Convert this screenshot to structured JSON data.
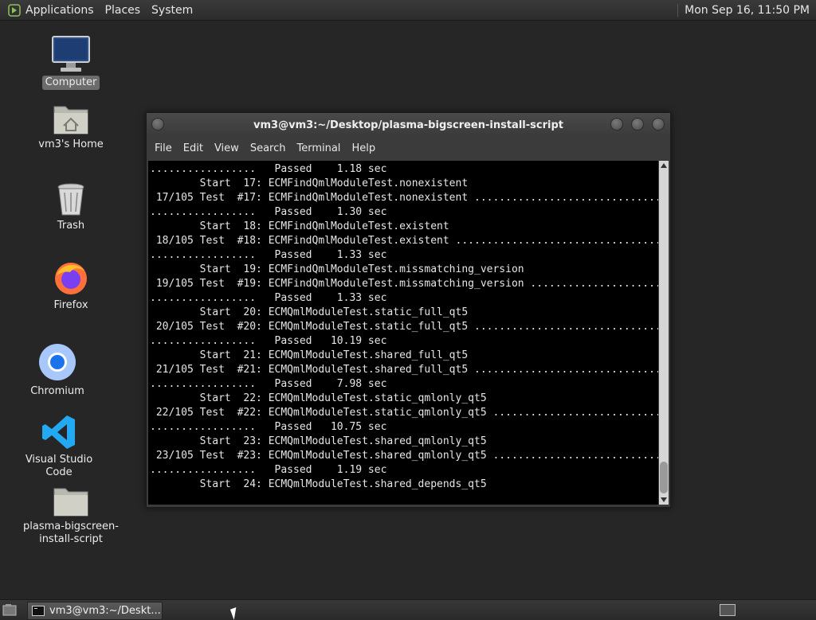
{
  "top_panel": {
    "menus": [
      "Applications",
      "Places",
      "System"
    ],
    "clock": "Mon Sep 16, 11:50 PM"
  },
  "desktop_icons": [
    {
      "label": "Computer",
      "icon": "computer-icon"
    },
    {
      "label": "vm3's Home",
      "icon": "home-folder-icon"
    },
    {
      "label": "Trash",
      "icon": "trash-icon"
    },
    {
      "label": "Firefox",
      "icon": "firefox-icon"
    },
    {
      "label": "Chromium",
      "icon": "chromium-icon"
    },
    {
      "label": "Visual Studio Code",
      "icon": "vscode-icon"
    },
    {
      "label": "plasma-bigscreen-\ninstall-script",
      "icon": "folder-icon"
    }
  ],
  "terminal": {
    "title": "vm3@vm3:~/Desktop/plasma-bigscreen-install-script",
    "menus": [
      "File",
      "Edit",
      "View",
      "Search",
      "Terminal",
      "Help"
    ],
    "lines": [
      ".................   Passed    1.18 sec",
      "        Start  17: ECMFindQmlModuleTest.nonexistent",
      " 17/105 Test  #17: ECMFindQmlModuleTest.nonexistent ..............................",
      ".................   Passed    1.30 sec",
      "        Start  18: ECMFindQmlModuleTest.existent",
      " 18/105 Test  #18: ECMFindQmlModuleTest.existent .................................",
      ".................   Passed    1.33 sec",
      "        Start  19: ECMFindQmlModuleTest.missmatching_version",
      " 19/105 Test  #19: ECMFindQmlModuleTest.missmatching_version .....................",
      ".................   Passed    1.33 sec",
      "        Start  20: ECMQmlModuleTest.static_full_qt5",
      " 20/105 Test  #20: ECMQmlModuleTest.static_full_qt5 ..............................",
      ".................   Passed   10.19 sec",
      "        Start  21: ECMQmlModuleTest.shared_full_qt5",
      " 21/105 Test  #21: ECMQmlModuleTest.shared_full_qt5 ..............................",
      ".................   Passed    7.98 sec",
      "        Start  22: ECMQmlModuleTest.static_qmlonly_qt5",
      " 22/105 Test  #22: ECMQmlModuleTest.static_qmlonly_qt5 ...........................",
      ".................   Passed   10.75 sec",
      "        Start  23: ECMQmlModuleTest.shared_qmlonly_qt5",
      " 23/105 Test  #23: ECMQmlModuleTest.shared_qmlonly_qt5 ...........................",
      ".................   Passed    1.19 sec",
      "        Start  24: ECMQmlModuleTest.shared_depends_qt5"
    ]
  },
  "taskbar": {
    "task_label": "vm3@vm3:~/Deskt..."
  },
  "colors": {
    "desktop_bg": "#262626",
    "terminal_bg": "#000000",
    "terminal_fg": "#e6e6e6"
  }
}
